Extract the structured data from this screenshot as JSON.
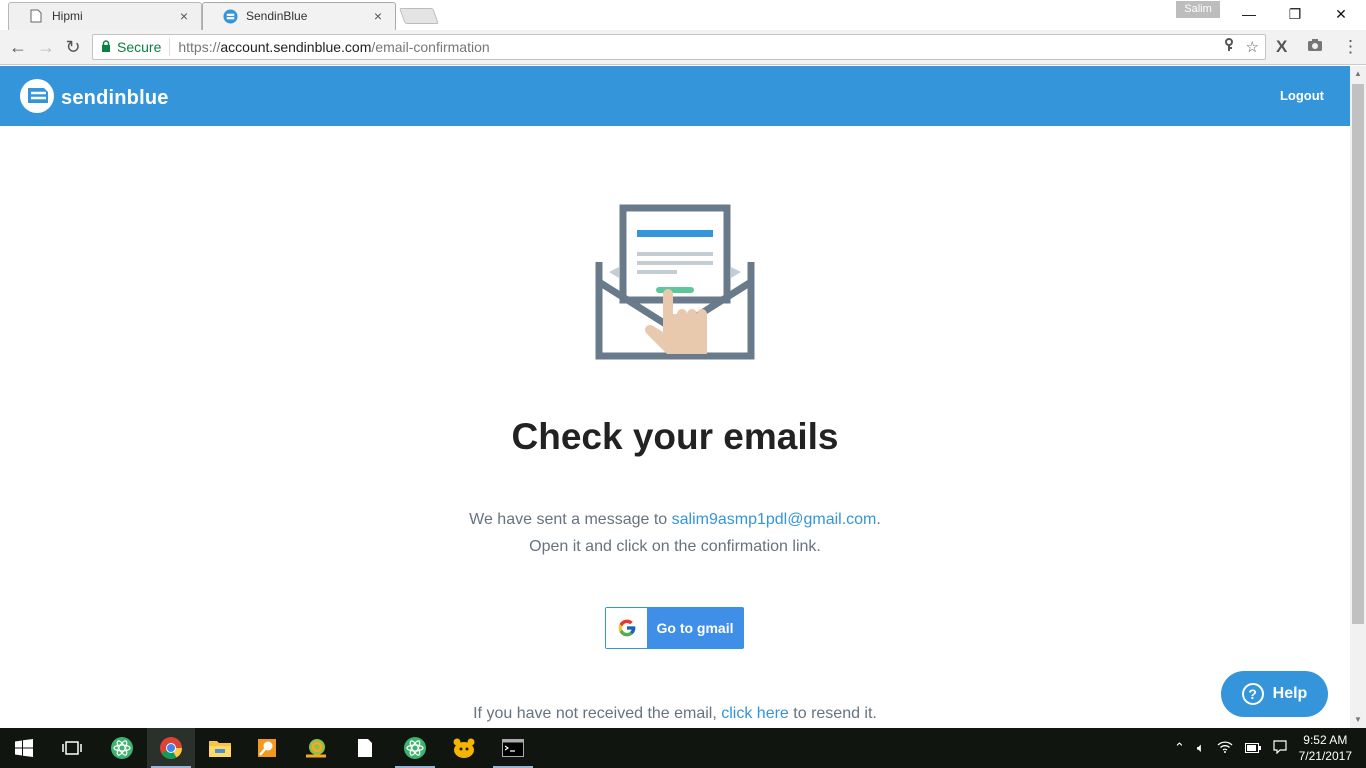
{
  "browser": {
    "tabs": [
      {
        "title": "Hipmi",
        "close": "×"
      },
      {
        "title": "SendinBlue",
        "close": "×"
      }
    ],
    "profile_name": "Salim",
    "window_controls": {
      "minimize": "—",
      "restore": "❐",
      "close": "✕"
    },
    "nav": {
      "back": "←",
      "forward": "→",
      "reload": "↻"
    },
    "secure_label": "Secure",
    "url_prefix": "https://",
    "url_host": "account.sendinblue.com",
    "url_path": "/email-confirmation",
    "icons": [
      "lock-icon",
      "key-icon",
      "star-icon",
      "extension-x-icon",
      "camera-icon",
      "menu-dots-icon"
    ]
  },
  "header": {
    "brand": "sendinblue",
    "logout": "Logout",
    "brand_color": "#3495da"
  },
  "main": {
    "headline": "Check your emails",
    "message_prefix": "We have sent a message to ",
    "email": "salim9asmp1pdl@gmail.com",
    "message_suffix": ".",
    "message_line2": "Open it and click on the confirmation link.",
    "gmail_button": "Go to gmail",
    "resend_prefix": "If you have not received the email, ",
    "resend_link": "click here",
    "resend_suffix": " to resend it."
  },
  "help": {
    "label": "Help",
    "icon": "?"
  },
  "taskbar": {
    "apps": [
      "windows-start-icon",
      "task-view-icon",
      "atom-icon",
      "chrome-icon",
      "file-explorer-icon",
      "search-app-icon",
      "snail-app-icon",
      "document-icon",
      "atom-icon",
      "squirrel-app-icon",
      "terminal-icon"
    ],
    "time": "9:52 AM",
    "date": "7/21/2017"
  }
}
